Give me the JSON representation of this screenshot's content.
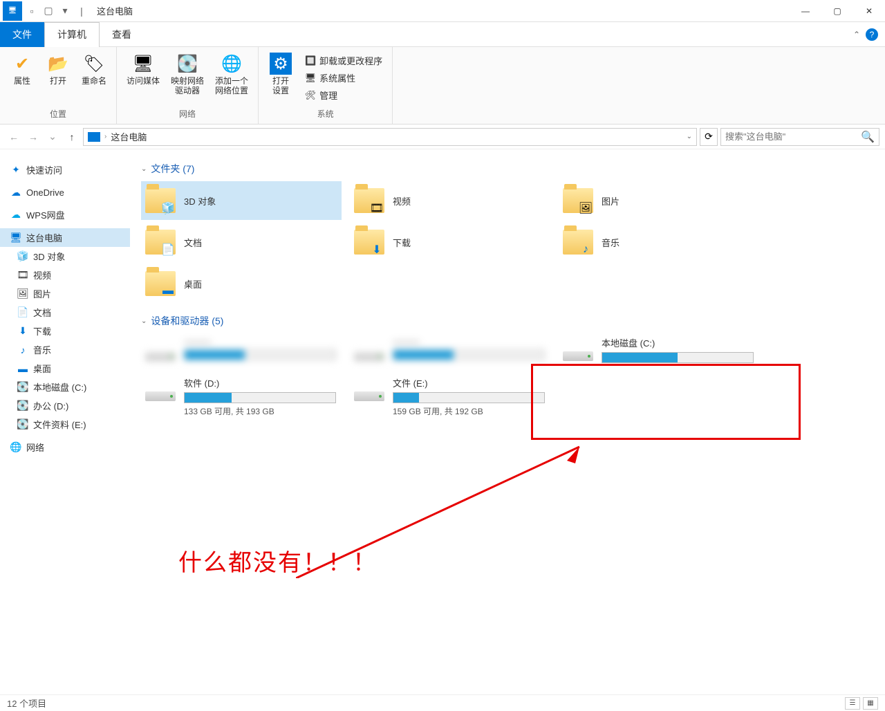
{
  "window": {
    "title": "这台电脑"
  },
  "tabs": {
    "file": "文件",
    "computer": "计算机",
    "view": "查看"
  },
  "ribbon": {
    "group_location": "位置",
    "group_network": "网络",
    "group_system": "系统",
    "properties": "属性",
    "open": "打开",
    "rename": "重命名",
    "access_media": "访问媒体",
    "map_drive": "映射网络\n驱动器",
    "add_location": "添加一个\n网络位置",
    "open_settings": "打开\n设置",
    "uninstall": "卸载或更改程序",
    "system_props": "系统属性",
    "manage": "管理"
  },
  "address": {
    "crumb": "这台电脑"
  },
  "search": {
    "placeholder": "搜索\"这台电脑\""
  },
  "sidebar": {
    "quick_access": "快速访问",
    "onedrive": "OneDrive",
    "wps": "WPS网盘",
    "this_pc": "这台电脑",
    "objects_3d": "3D 对象",
    "videos": "视频",
    "pictures": "图片",
    "documents": "文档",
    "downloads": "下载",
    "music": "音乐",
    "desktop": "桌面",
    "local_c": "本地磁盘 (C:)",
    "office_d": "办公 (D:)",
    "files_e": "文件资料 (E:)",
    "network": "网络"
  },
  "sections": {
    "folders": "文件夹 (7)",
    "devices": "设备和驱动器 (5)"
  },
  "folders": {
    "objects_3d": "3D 对象",
    "videos": "视频",
    "pictures": "图片",
    "documents": "文档",
    "downloads": "下载",
    "music": "音乐",
    "desktop": "桌面"
  },
  "drives": {
    "c": {
      "name": "本地磁盘 (C:)",
      "free": "",
      "fill_pct": 50
    },
    "d": {
      "name": "软件 (D:)",
      "free": "133 GB 可用, 共 193 GB",
      "fill_pct": 31
    },
    "e": {
      "name": "文件 (E:)",
      "free": "159 GB 可用, 共 192 GB",
      "fill_pct": 17
    }
  },
  "annotation": {
    "text": "什么都没有！！！"
  },
  "status": {
    "items": "12 个项目"
  }
}
